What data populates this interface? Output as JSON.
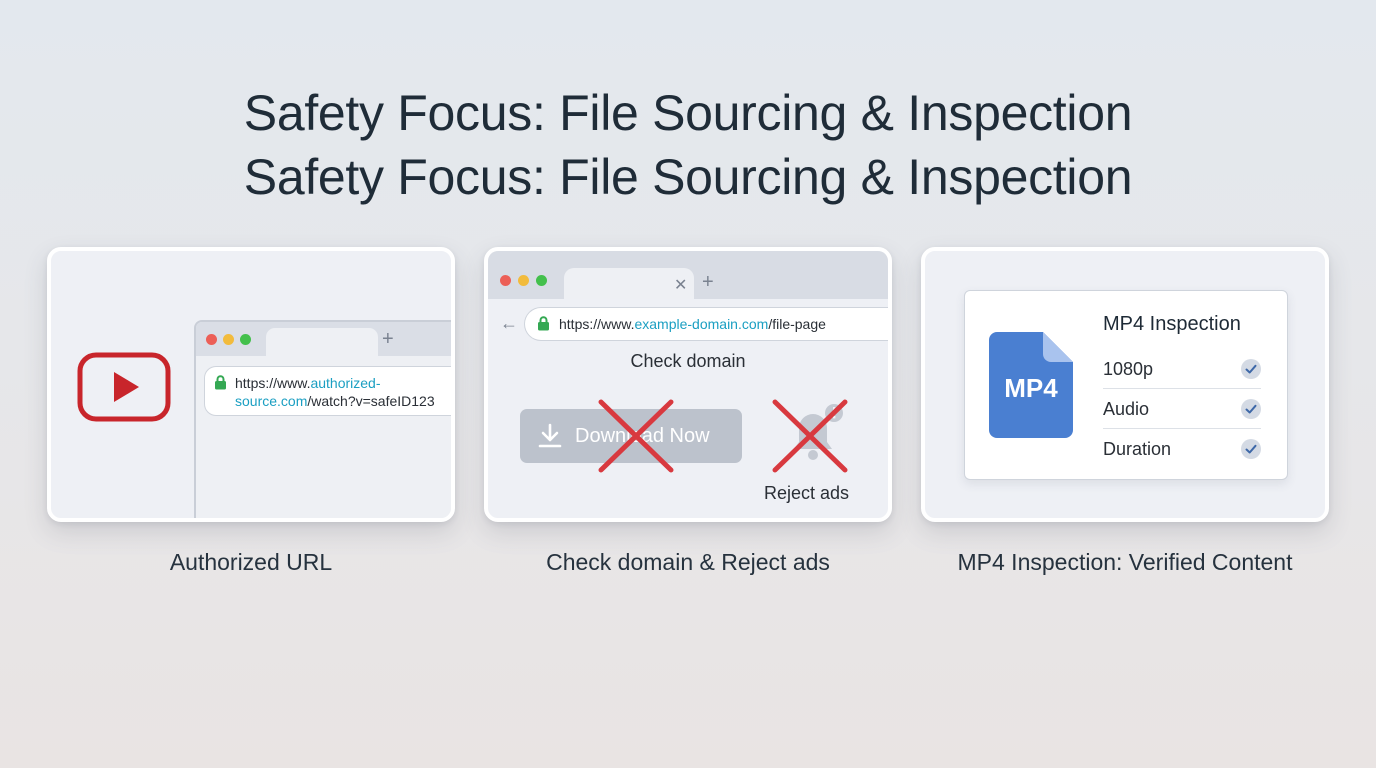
{
  "header": {
    "title_line_1": "Safety Focus: File Sourcing & Inspection",
    "title_line_2": "Safety Focus: File Sourcing & Inspection"
  },
  "panels": [
    {
      "caption": "Authorized URL",
      "logo_icon": "video-play-logo-icon",
      "url_prefix": "https://www.",
      "url_domain_part1": "authorized-",
      "url_domain_part2": "source.com",
      "url_path": "/watch?v=safeID123"
    },
    {
      "caption": "Check domain & Reject ads",
      "url_prefix": "https://www.",
      "url_domain": "example-domain.com",
      "url_path": "/file-page",
      "check_label": "Check domain",
      "download_button_label": "Download Now",
      "reject_label": "Reject ads"
    },
    {
      "caption": "MP4 Inspection: Verified Content",
      "file_badge": "MP4",
      "panel_title": "MP4 Inspection",
      "checks": [
        "1080p",
        "Audio",
        "Duration"
      ]
    }
  ],
  "colors": {
    "accent_link": "#1b9fc2",
    "reject_red": "#d8393f",
    "logo_red": "#c8252b",
    "file_blue": "#4a7fd1",
    "lock_green": "#34a853"
  }
}
